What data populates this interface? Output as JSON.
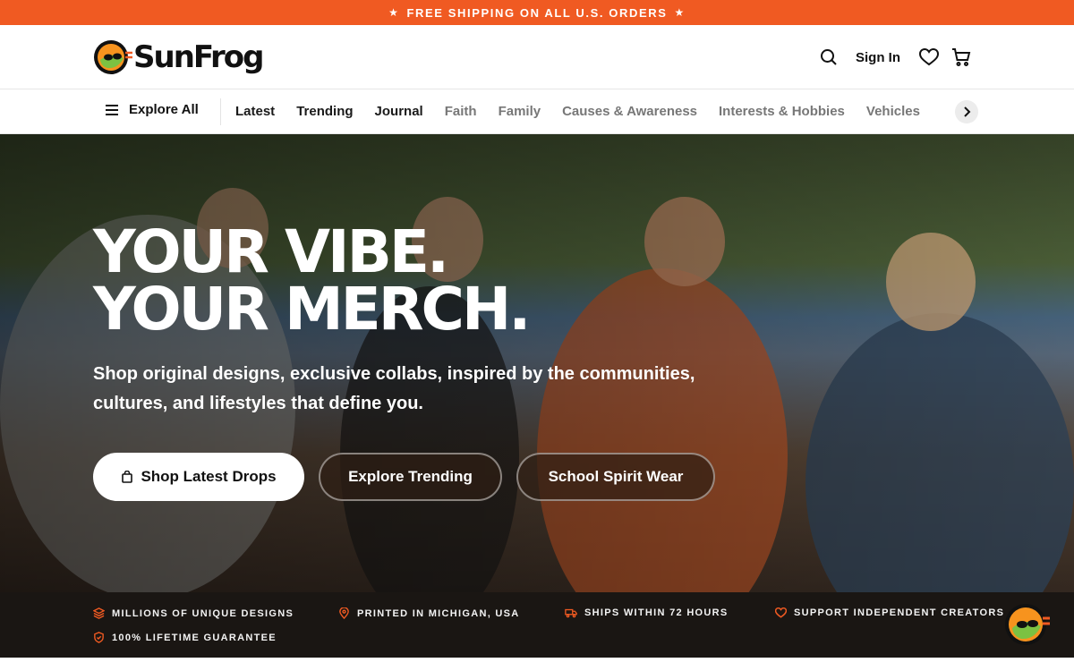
{
  "promo": {
    "text": "FREE SHIPPING ON ALL U.S. ORDERS",
    "star": "★"
  },
  "header": {
    "brand": "SunFrog",
    "signin_label": "Sign In",
    "icons": [
      "search-icon",
      "heart-icon",
      "cart-icon"
    ]
  },
  "nav": {
    "explore_label": "Explore All",
    "items": [
      {
        "label": "Latest"
      },
      {
        "label": "Trending"
      },
      {
        "label": "Journal"
      },
      {
        "label": "Faith"
      },
      {
        "label": "Family"
      },
      {
        "label": "Causes & Awareness"
      },
      {
        "label": "Interests & Hobbies"
      },
      {
        "label": "Vehicles"
      }
    ]
  },
  "hero": {
    "title_line1": "YOUR VIBE.",
    "title_line2": "YOUR MERCH.",
    "subtitle": "Shop original designs, exclusive collabs, inspired by the communities, cultures, and lifestyles that define you.",
    "cta_primary": "Shop Latest Drops",
    "cta_secondary": "Explore Trending",
    "cta_tertiary": "School Spirit Wear"
  },
  "features": [
    {
      "label": "MILLIONS OF UNIQUE DESIGNS",
      "icon": "layers-icon"
    },
    {
      "label": "PRINTED IN MICHIGAN, USA",
      "icon": "map-pin-icon"
    },
    {
      "label": "SHIPS WITHIN 72 HOURS",
      "icon": "truck-icon"
    },
    {
      "label": "SUPPORT INDEPENDENT CREATORS",
      "icon": "heart-icon"
    },
    {
      "label": "100% LIFETIME GUARANTEE",
      "icon": "shield-check-icon"
    }
  ],
  "colors": {
    "accent": "#f05a22",
    "dark": "#1a1613"
  }
}
